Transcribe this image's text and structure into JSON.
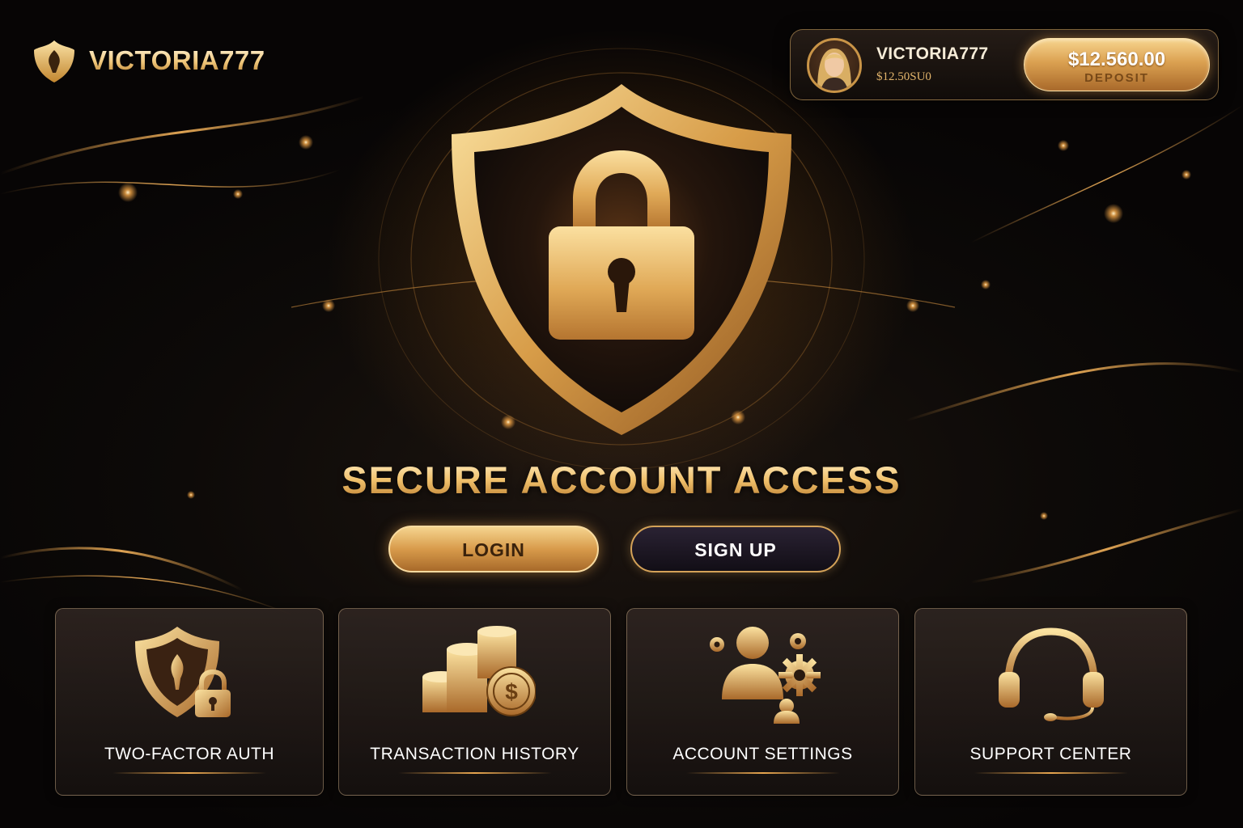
{
  "brand": {
    "name": "VICTORIA777",
    "logo_icon": "crest-shield-icon"
  },
  "account": {
    "username": "VICTORIA777",
    "balance_sub": "$12.50SU0",
    "avatar_icon": "user-avatar",
    "deposit": {
      "amount": "$12.560.00",
      "label": "DEPOSIT"
    }
  },
  "hero": {
    "emblem_icon": "shield-padlock-icon",
    "title": "SECURE ACCOUNT ACCESS",
    "login_label": "LOGIN",
    "signup_label": "SIGN UP"
  },
  "features": [
    {
      "label": "TWO-FACTOR AUTH",
      "icon": "shield-lock-icon"
    },
    {
      "label": "TRANSACTION HISTORY",
      "icon": "coin-stacks-icon"
    },
    {
      "label": "ACCOUNT SETTINGS",
      "icon": "user-gears-icon"
    },
    {
      "label": "SUPPORT CENTER",
      "icon": "headset-icon"
    }
  ],
  "colors": {
    "background": "#0d0a08",
    "gold_light": "#f7d58f",
    "gold_mid": "#d89b4b",
    "gold_dark": "#a86a2a",
    "text": "#ffffff"
  }
}
